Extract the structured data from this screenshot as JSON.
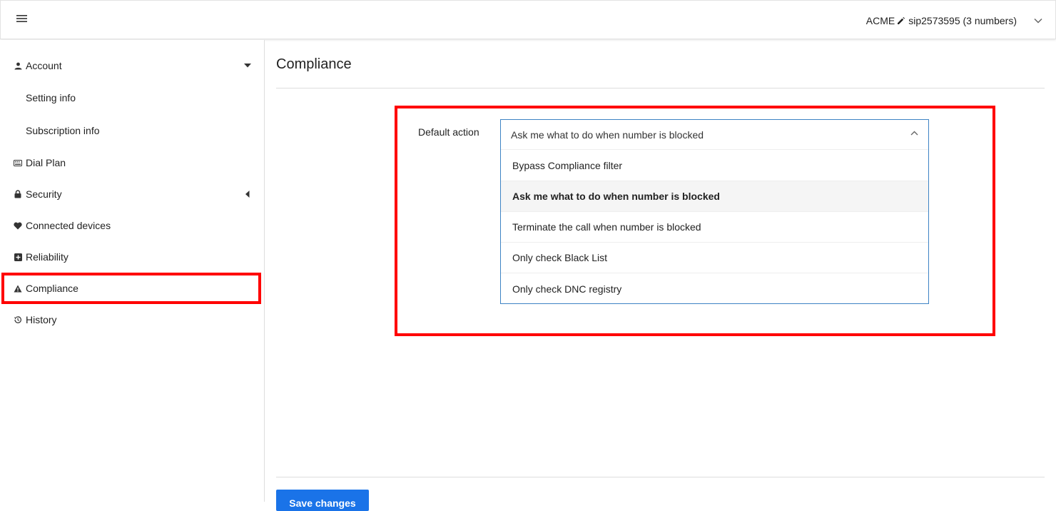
{
  "header": {
    "account_name": "ACME",
    "account_detail": "sip2573595 (3 numbers)"
  },
  "sidebar": {
    "items": [
      {
        "label": "Account",
        "icon": "person-icon",
        "arrow": "caret-down"
      },
      {
        "label": "Setting info"
      },
      {
        "label": "Subscription info"
      },
      {
        "label": "Dial Plan",
        "icon": "keyboard-icon"
      },
      {
        "label": "Security",
        "icon": "lock-icon",
        "arrow": "caret-left"
      },
      {
        "label": "Connected devices",
        "icon": "heart-icon"
      },
      {
        "label": "Reliability",
        "icon": "plus-box-icon"
      },
      {
        "label": "Compliance",
        "icon": "warning-icon",
        "active": true
      },
      {
        "label": "History",
        "icon": "history-icon"
      }
    ]
  },
  "main": {
    "title": "Compliance",
    "field_label": "Default action",
    "select": {
      "value": "Ask me what to do when number is blocked",
      "options": [
        "Bypass Compliance filter",
        "Ask me what to do when number is blocked",
        "Terminate the call when number is blocked",
        "Only check Black List",
        "Only check DNC registry"
      ],
      "selected_index": 1
    },
    "save_label": "Save changes"
  },
  "colors": {
    "highlight": "#ff0000",
    "select_border": "#3d83c4",
    "primary_button": "#1a73e8"
  }
}
